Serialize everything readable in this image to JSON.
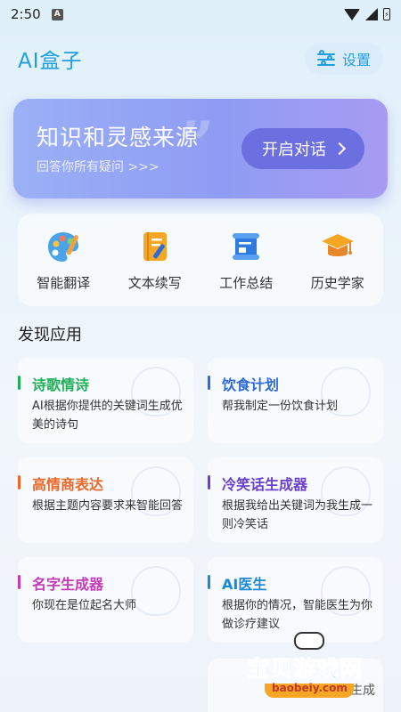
{
  "status_bar": {
    "time": "2:50",
    "notification_icon": "A"
  },
  "header": {
    "title": "AI盒子",
    "settings_label": "设置"
  },
  "banner": {
    "title": "知识和灵感来源",
    "subtitle": "回答你所有疑问 >>>",
    "button_label": "开启对话",
    "quote_mark": "”"
  },
  "tools": [
    {
      "label": "智能翻译",
      "icon": "palette-icon"
    },
    {
      "label": "文本续写",
      "icon": "notebook-pencil-icon"
    },
    {
      "label": "工作总结",
      "icon": "document-scroll-icon"
    },
    {
      "label": "历史学家",
      "icon": "graduation-cap-icon"
    }
  ],
  "section_title": "发现应用",
  "apps": [
    {
      "title": "诗歌情诗",
      "desc": "AI根据你提供的关键词生成优美的诗句",
      "color": "#1fae5a"
    },
    {
      "title": "饮食计划",
      "desc": "帮我制定一份饮食计划",
      "color": "#2f6bd8"
    },
    {
      "title": "高情商表达",
      "desc": "根据主题内容要求来智能回答",
      "color": "#e8692a"
    },
    {
      "title": "冷笑话生成器",
      "desc": "根据我给出关键词为我生成一则冷笑话",
      "color": "#6a3fcf"
    },
    {
      "title": "名字生成器",
      "desc": "你现在是位起名大师",
      "color": "#c43bb8"
    },
    {
      "title": "AI医生",
      "desc": "根据你的情况，智能医生为你做诊疗建议",
      "color": "#1a8ad8"
    }
  ],
  "partial_card_text": "生成",
  "watermark": {
    "text": "宝贝游戏网",
    "url": "baobeiy.com"
  }
}
